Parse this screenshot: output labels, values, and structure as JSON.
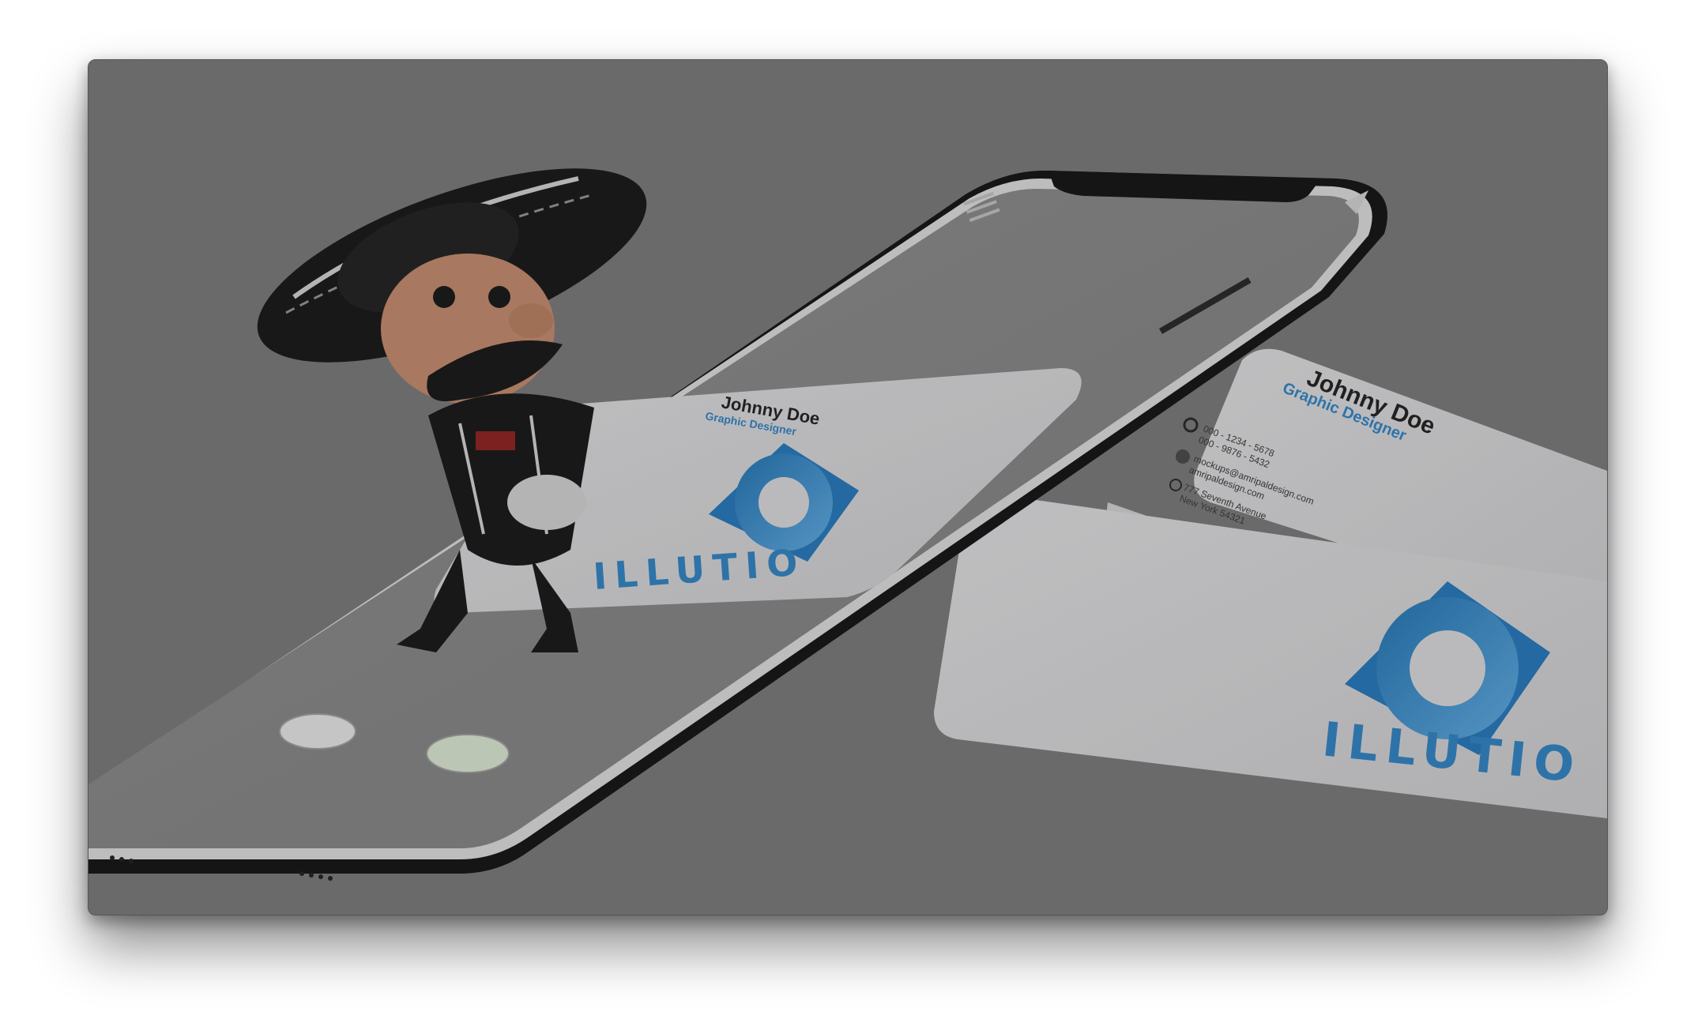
{
  "scene": {
    "brand_name": "ILLUTIO",
    "card_name": "Johnny Doe",
    "card_role": "Graphic Designer",
    "phone_line_1": "000 - 1234 - 5678",
    "phone_line_2": "000 - 9876 - 5432",
    "email_line_1": "mockups@amripaldesign.com",
    "email_line_2": "amripaldesign.com",
    "address_line_1": "777 Seventh Avenue",
    "address_line_2": "New York 54321"
  },
  "colors": {
    "background": "#757575",
    "card": "#d6d6d8",
    "brand_blue": "#2b7fc0",
    "phone_frame": "#111111"
  }
}
